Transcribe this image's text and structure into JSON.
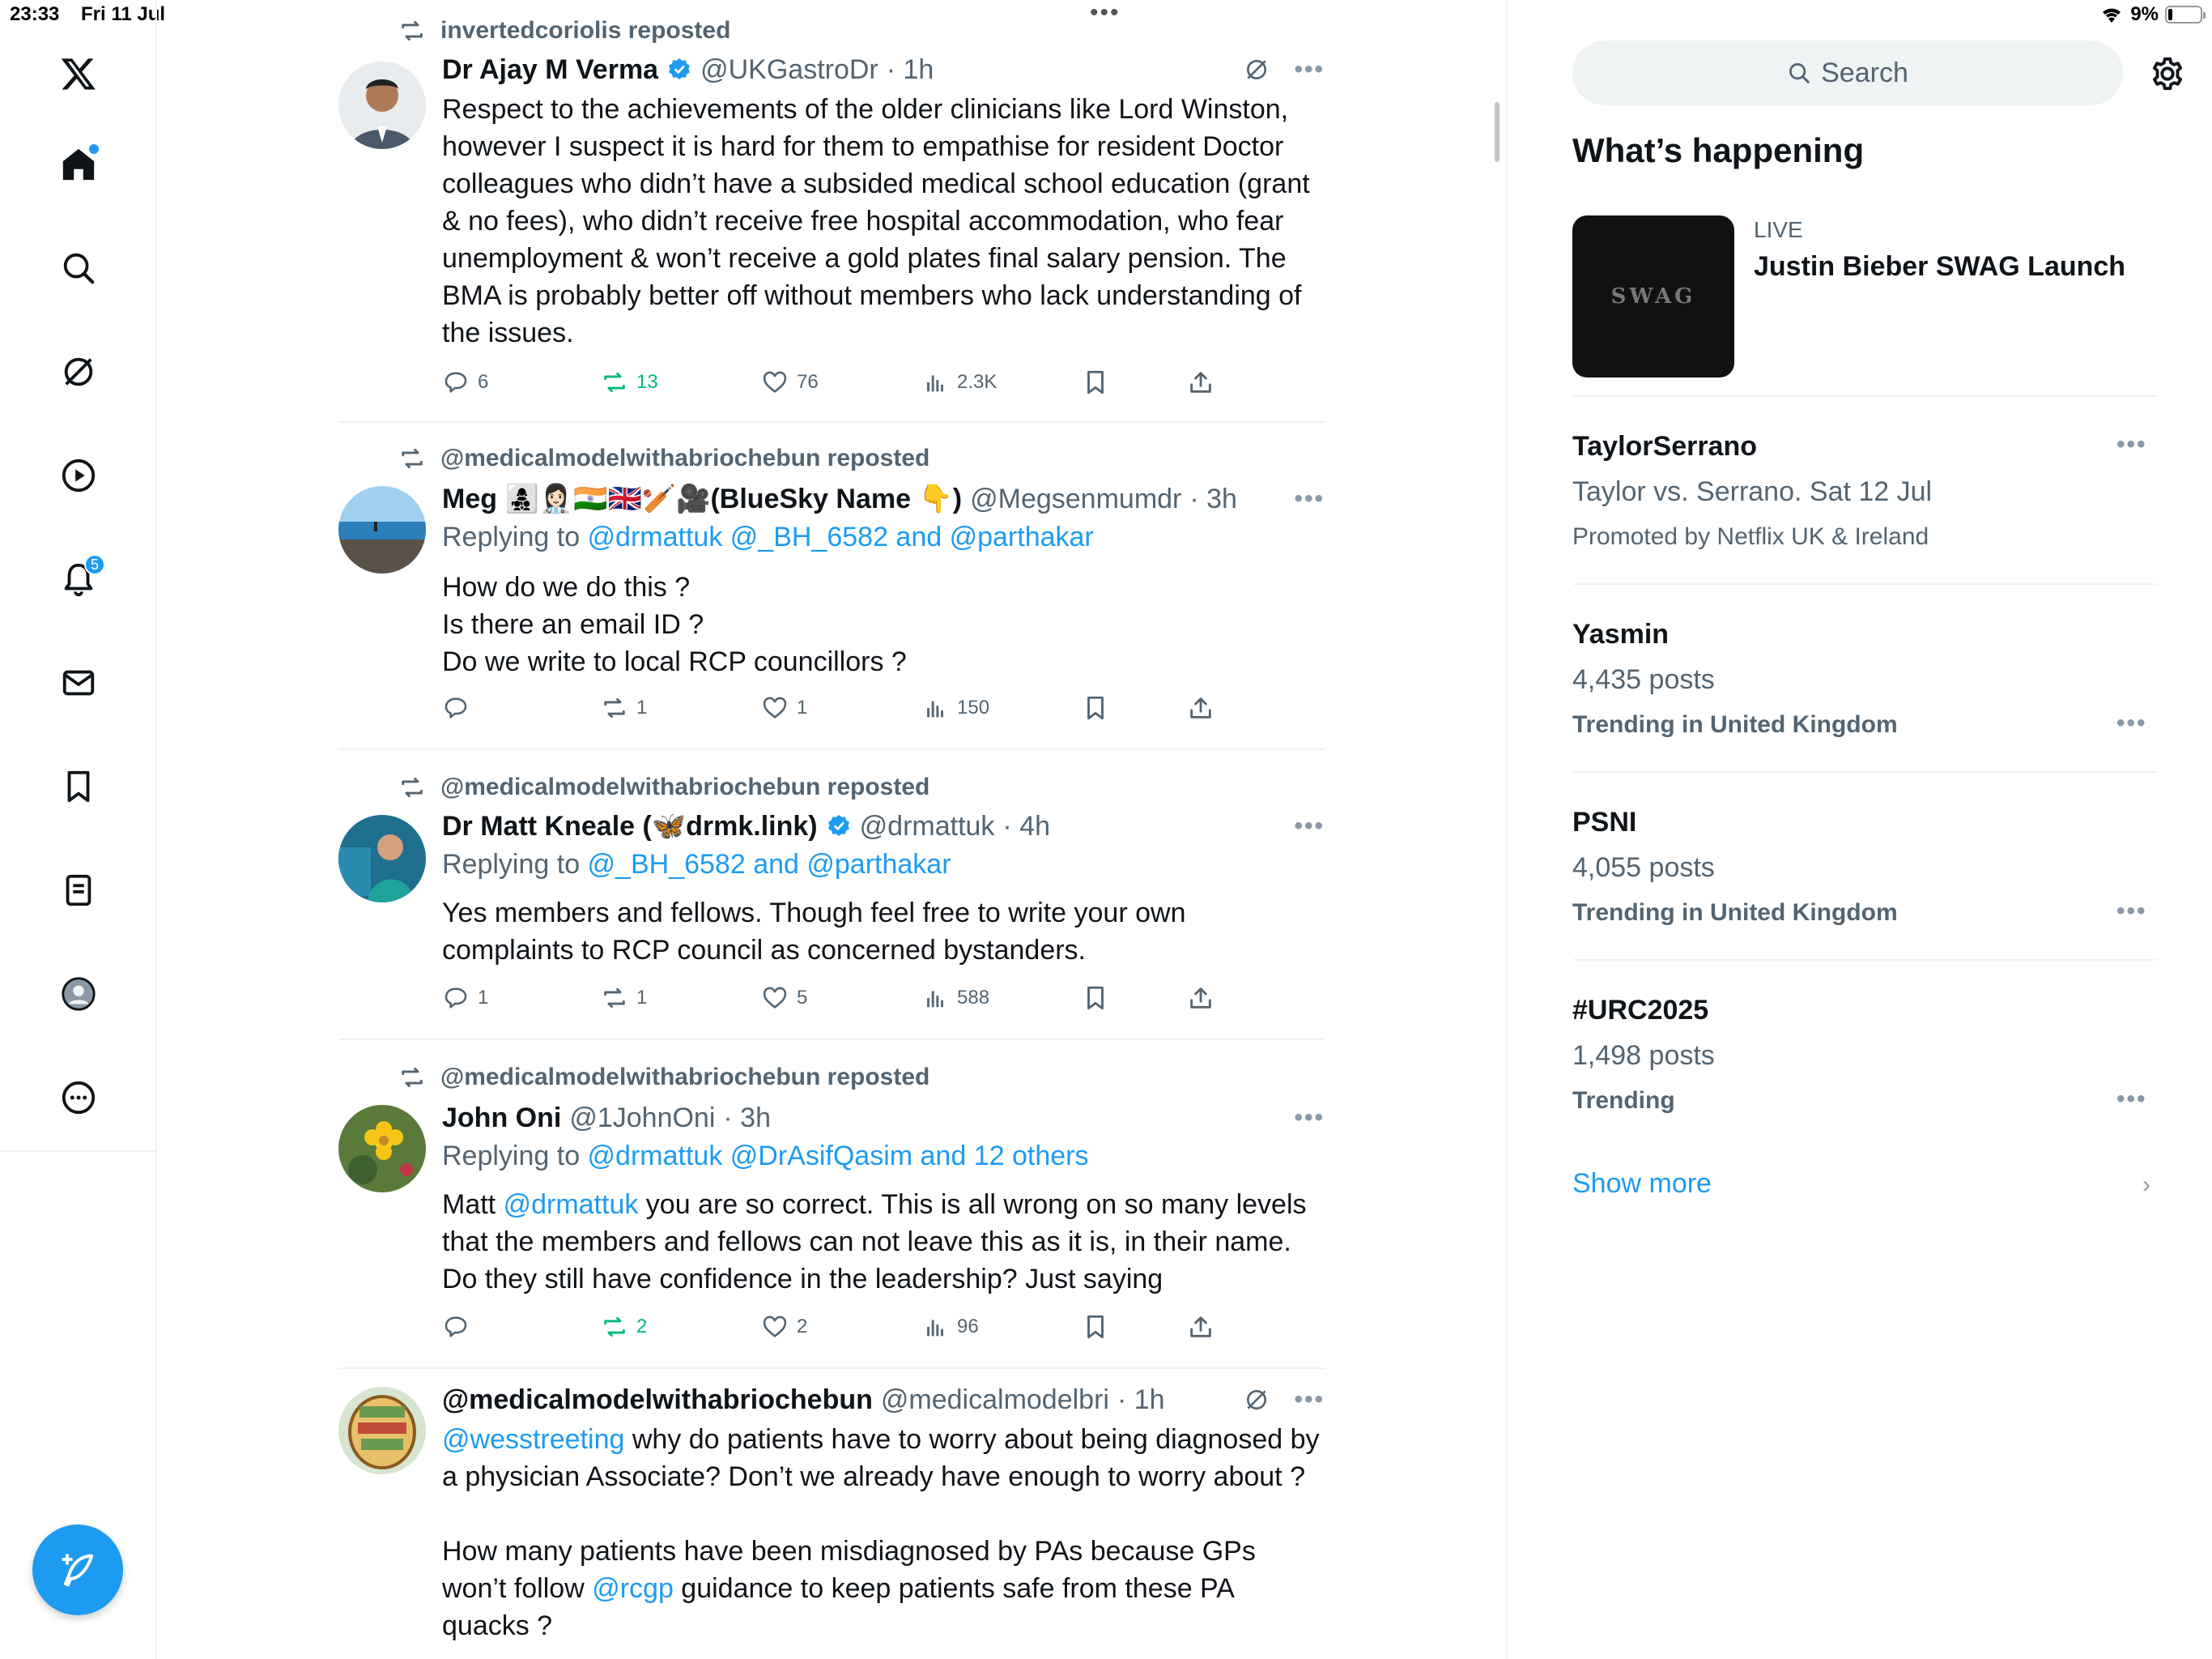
{
  "status_bar": {
    "time": "23:33",
    "date": "Fri 11 Jul",
    "battery": "9%"
  },
  "nav": {
    "notifications_badge": "5"
  },
  "feed": {
    "posts": [
      {
        "repost_by": "invertedcoriolis reposted",
        "name": "Dr Ajay M Verma",
        "handle": "@UKGastroDr",
        "time": "· 1h",
        "text": "Respect to the achievements of the older clinicians like Lord Winston, however I suspect it is hard for them to empathise for resident Doctor colleagues who didn’t have a subsided medical school education (grant & no fees), who didn’t receive free hospital accommodation, who fear unemployment & won’t receive a gold plates final salary pension. The BMA is probably better off without members who lack understanding of the issues.",
        "replies": "6",
        "reposts": "13",
        "likes": "76",
        "views": "2.3K"
      },
      {
        "repost_by": "@medicalmodelwithabriochebun reposted",
        "name": "Meg 👩‍👧‍👦👩🏻‍⚕️🇮🇳🇬🇧🏏🎥(BlueSky Name 👇)",
        "handle": "@Megsenmumdr",
        "time": "· 3h",
        "replying_prefix": "Replying to ",
        "replying_to": "@drmattuk @_BH_6582 and @parthakar",
        "lines": [
          "How do we do this ?",
          "Is there an email ID ?",
          "Do we write to local RCP councillors ?"
        ],
        "replies": "",
        "reposts": "1",
        "likes": "1",
        "views": "150"
      },
      {
        "repost_by": "@medicalmodelwithabriochebun reposted",
        "name": "Dr Matt Kneale (🦋drmk.link)",
        "handle": "@drmattuk",
        "time": "· 4h",
        "replying_prefix": "Replying to ",
        "replying_to": "@_BH_6582 and @parthakar",
        "text": "Yes members and fellows. Though feel free to write your own complaints to RCP council as concerned bystanders.",
        "replies": "1",
        "reposts": "1",
        "likes": "5",
        "views": "588"
      },
      {
        "repost_by": "@medicalmodelwithabriochebun reposted",
        "name": "John Oni",
        "handle": "@1JohnOni",
        "time": "· 3h",
        "replying_prefix": "Replying to ",
        "replying_to": "@drmattuk @DrAsifQasim and 12 others",
        "text_prefix": "Matt ",
        "text_mention": "@drmattuk",
        "text_rest": " you are so correct. This is all wrong on so many levels that the members and fellows can not leave this as it is, in their name. Do they still have confidence in the leadership? Just saying",
        "replies": "",
        "reposts": "2",
        "likes": "2",
        "views": "96"
      },
      {
        "name": "@medicalmodelwithabriochebun",
        "handle": "@medicalmodelbri",
        "time": "· 1h",
        "text_mention": "@wesstreeting",
        "text_rest": " why do patients have to worry about being diagnosed by a physician Associate? Don’t we already have enough to worry about ?",
        "text2_prefix": "How many patients have been misdiagnosed by PAs because GPs won’t follow ",
        "text2_mention": "@rcgp",
        "text2_rest": " guidance to keep patients safe from these PA quacks ?"
      }
    ]
  },
  "sidebar": {
    "search_placeholder": "Search",
    "whats_happening": "What’s happening",
    "live_label": "LIVE",
    "live_title": "Justin Bieber SWAG Launch",
    "live_thumb_text": "SWAG",
    "trends": [
      {
        "name": "TaylorSerrano",
        "sub": "Taylor vs. Serrano. Sat 12 Jul",
        "meta": "Promoted by Netflix UK & Ireland"
      },
      {
        "name": "Yasmin",
        "sub": "4,435 posts",
        "meta": "Trending in United Kingdom"
      },
      {
        "name": "PSNI",
        "sub": "4,055 posts",
        "meta": "Trending in United Kingdom"
      },
      {
        "name": "#URC2025",
        "sub": "1,498 posts",
        "meta": "Trending"
      }
    ],
    "show_more": "Show more"
  },
  "colors": {
    "accent": "#1d9bf0",
    "muted": "#536471",
    "repost_green": "#00ba7c"
  }
}
